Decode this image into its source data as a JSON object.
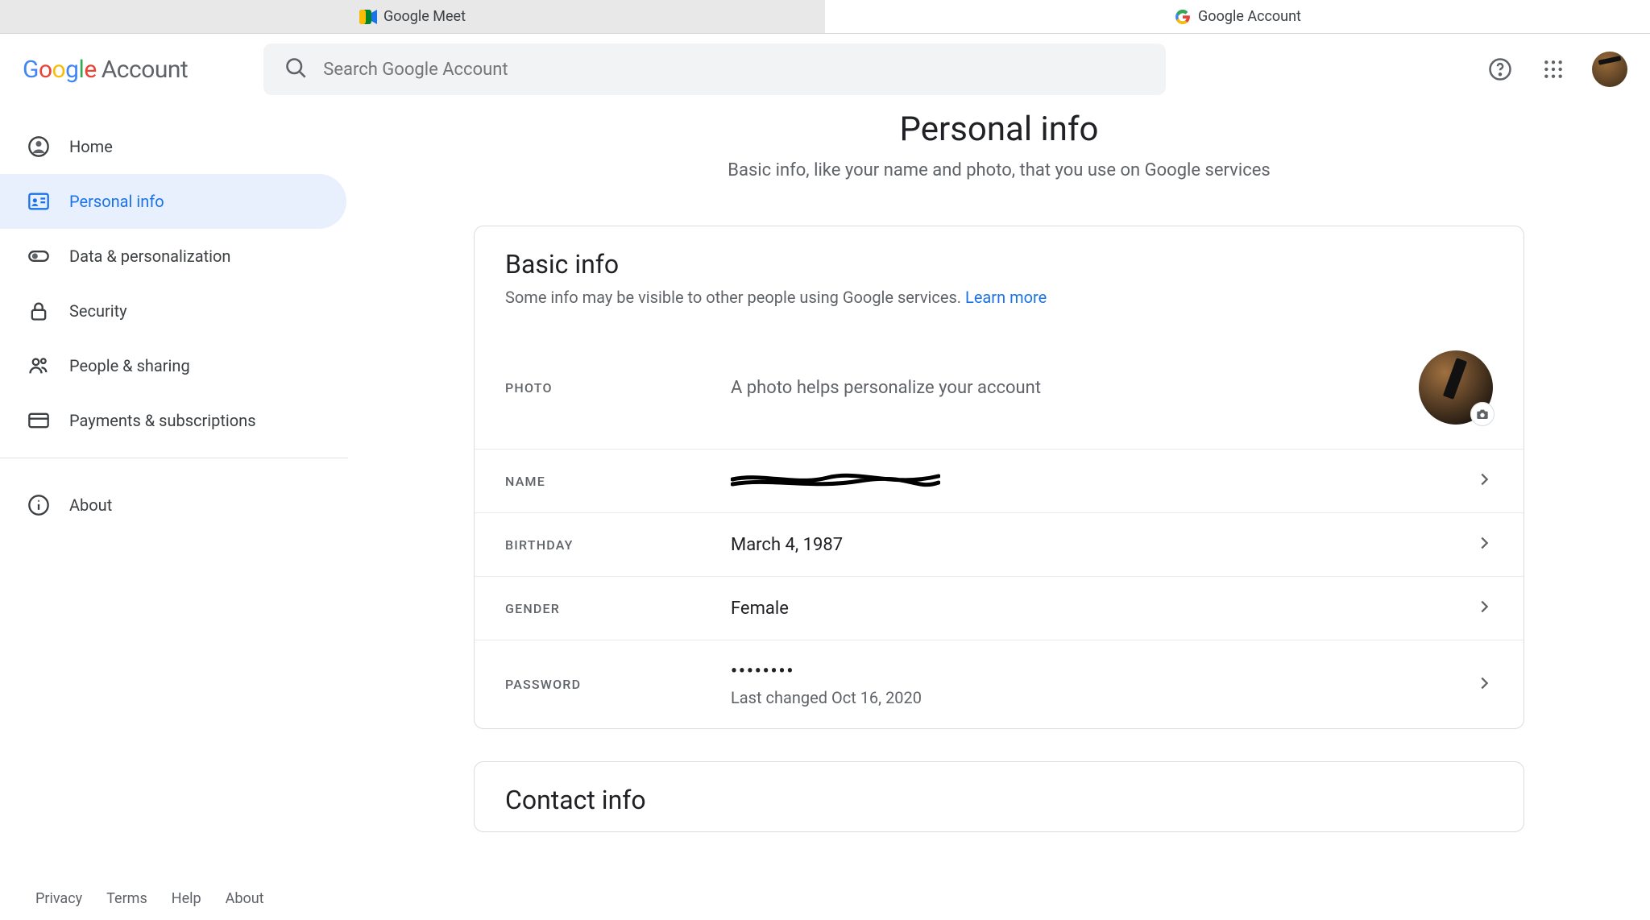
{
  "browser_tabs": [
    {
      "label": "Google Meet",
      "active": false
    },
    {
      "label": "Google Account",
      "active": true
    }
  ],
  "header": {
    "logo_google": "Google",
    "logo_account": "Account",
    "search_placeholder": "Search Google Account"
  },
  "sidebar": {
    "items": [
      {
        "label": "Home"
      },
      {
        "label": "Personal info"
      },
      {
        "label": "Data & personalization"
      },
      {
        "label": "Security"
      },
      {
        "label": "People & sharing"
      },
      {
        "label": "Payments & subscriptions"
      }
    ],
    "about_label": "About"
  },
  "page": {
    "title": "Personal info",
    "subtitle": "Basic info, like your name and photo, that you use on Google services"
  },
  "basic_info": {
    "title": "Basic info",
    "subtitle_text": "Some info may be visible to other people using Google services. ",
    "learn_more": "Learn more",
    "rows": {
      "photo": {
        "label": "PHOTO",
        "value": "A photo helps personalize your account"
      },
      "name": {
        "label": "NAME",
        "value": ""
      },
      "birthday": {
        "label": "BIRTHDAY",
        "value": "March 4, 1987"
      },
      "gender": {
        "label": "GENDER",
        "value": "Female"
      },
      "password": {
        "label": "PASSWORD",
        "value": "••••••••",
        "sub": "Last changed Oct 16, 2020"
      }
    }
  },
  "contact_info": {
    "title": "Contact info"
  },
  "footer": {
    "privacy": "Privacy",
    "terms": "Terms",
    "help": "Help",
    "about": "About"
  }
}
